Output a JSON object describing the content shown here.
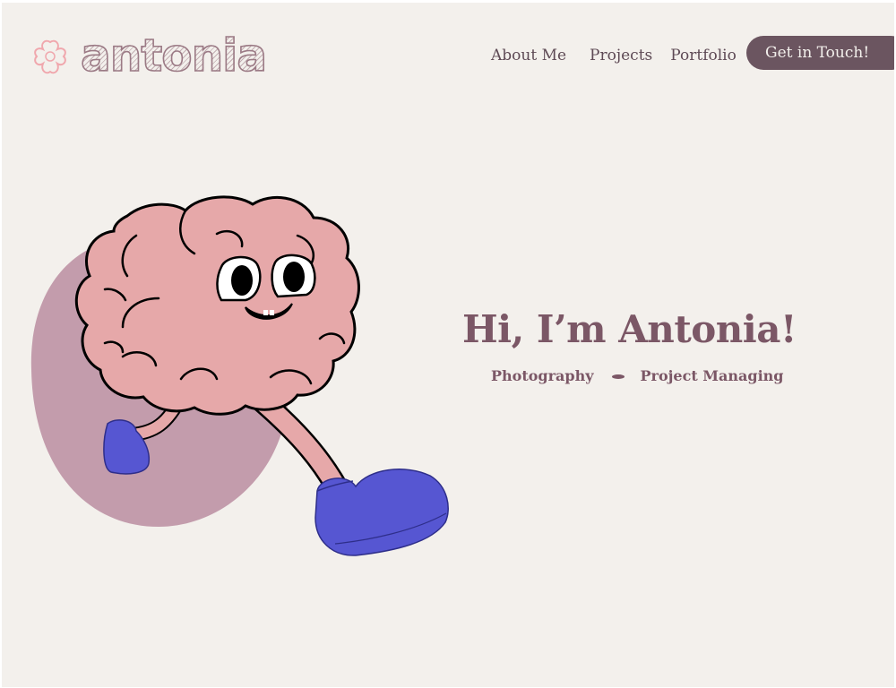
{
  "header": {
    "logo_text": "antonia",
    "nav": [
      {
        "label": "About Me"
      },
      {
        "label": "Projects"
      },
      {
        "label": "Portfolio"
      }
    ],
    "cta_label": "Get in Touch!"
  },
  "hero": {
    "headline": "Hi, I’m Antonia!",
    "tags": [
      "Photography",
      "Project Managing"
    ],
    "illustration": "running-brain-mascot"
  },
  "colors": {
    "background": "#f3f0ec",
    "accent": "#7b5766",
    "button": "#6b5560",
    "blob": "#c39cac",
    "brain": "#e6a8a9",
    "shoe": "#5656d2",
    "logo_flower": "#f0a7ad"
  }
}
